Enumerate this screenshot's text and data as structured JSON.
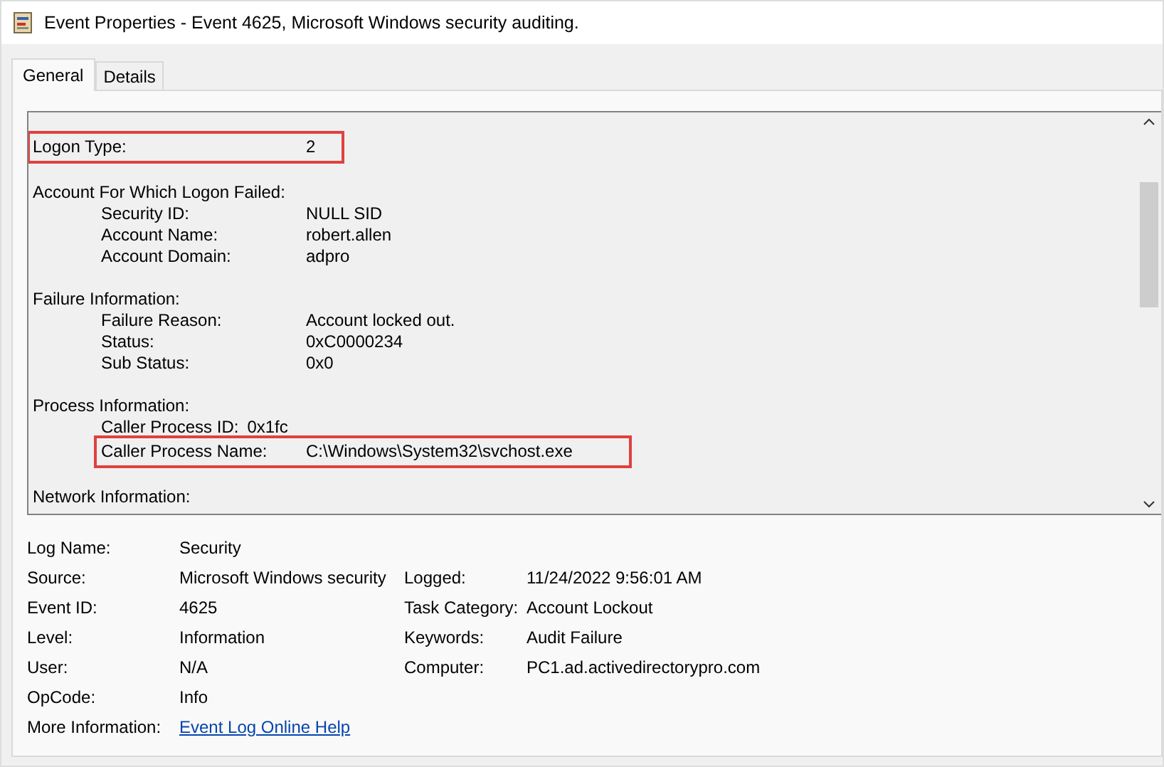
{
  "window": {
    "title": "Event Properties - Event 4625, Microsoft Windows security auditing."
  },
  "tabs": [
    {
      "label": "General",
      "selected": true
    },
    {
      "label": "Details",
      "selected": false
    }
  ],
  "description": [
    {
      "kind": "field",
      "label": "Logon Type:",
      "value": "2",
      "highlighted": true
    },
    {
      "kind": "section",
      "title": "Account For Which Logon Failed:",
      "fields": [
        {
          "kind": "column",
          "label": "Security ID:",
          "value": "NULL SID",
          "highlighted": false
        },
        {
          "kind": "column",
          "label": "Account Name:",
          "value": "robert.allen",
          "highlighted": false
        },
        {
          "kind": "column",
          "label": "Account Domain:",
          "value": "adpro",
          "highlighted": false
        }
      ]
    },
    {
      "kind": "section",
      "title": "Failure Information:",
      "fields": [
        {
          "kind": "column",
          "label": "Failure Reason:",
          "value": "Account locked out.",
          "highlighted": false
        },
        {
          "kind": "column",
          "label": "Status:",
          "value": "0xC0000234",
          "highlighted": false
        },
        {
          "kind": "column",
          "label": "Sub Status:",
          "value": "0x0",
          "highlighted": false
        }
      ]
    },
    {
      "kind": "section",
      "title": "Process Information:",
      "fields": [
        {
          "kind": "inline",
          "label": "Caller Process ID:",
          "value": "0x1fc",
          "highlighted": false
        },
        {
          "kind": "column",
          "label": "Caller Process Name:",
          "value": "C:\\Windows\\System32\\svchost.exe",
          "highlighted": true
        }
      ]
    },
    {
      "kind": "section",
      "title": "Network Information:"
    }
  ],
  "properties": [
    [
      {
        "label": "Log Name:",
        "value": "Security"
      }
    ],
    [
      {
        "label": "Source:",
        "value": "Microsoft Windows security"
      },
      {
        "label": "Logged:",
        "value": "11/24/2022 9:56:01 AM"
      }
    ],
    [
      {
        "label": "Event ID:",
        "value": "4625"
      },
      {
        "label": "Task Category:",
        "value": "Account Lockout"
      }
    ],
    [
      {
        "label": "Level:",
        "value": "Information"
      },
      {
        "label": "Keywords:",
        "value": "Audit Failure"
      }
    ],
    [
      {
        "label": "User:",
        "value": "N/A"
      },
      {
        "label": "Computer:",
        "value": "PC1.ad.activedirectorypro.com"
      }
    ],
    [
      {
        "label": "OpCode:",
        "value": "Info"
      }
    ]
  ],
  "more_information": {
    "label": "More Information:",
    "link": "Event Log Online Help"
  }
}
